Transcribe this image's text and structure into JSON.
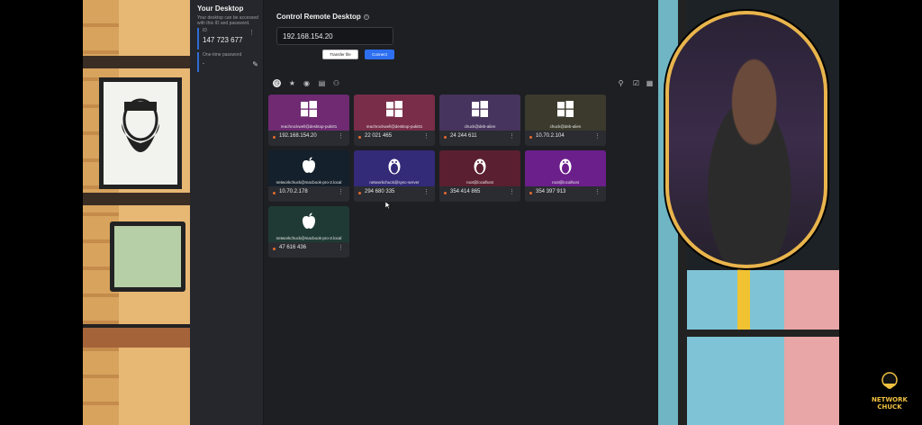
{
  "sidebar": {
    "title": "Your Desktop",
    "description": "Your desktop can be accessed with this ID and password.",
    "id_label": "ID",
    "id_value": "147 723 677",
    "password_label": "One-time password",
    "password_value": "-"
  },
  "remote": {
    "title": "Control Remote Desktop",
    "address_value": "192.168.154.20",
    "transfer_label": "Transfer file",
    "connect_label": "Connect"
  },
  "toolbar": {
    "icons": [
      "recent-icon",
      "favorites-icon",
      "discovered-icon",
      "address-book-icon",
      "group-icon"
    ],
    "right_icons": [
      "search-icon",
      "select-icon",
      "grid-view-icon"
    ]
  },
  "devices": [
    {
      "host": "reachrockwell@desktop-puki81",
      "id": "192.168.154.20",
      "os": "windows",
      "color": "#6f2a72"
    },
    {
      "host": "reachrockwell@desktop-puki81",
      "id": "22 021 465",
      "os": "windows",
      "color": "#7a2d48"
    },
    {
      "host": "chuck@deb-alien",
      "id": "24 244 611",
      "os": "windows",
      "color": "#47345e"
    },
    {
      "host": "chuck@deb-alien",
      "id": "10.70.2.104",
      "os": "windows",
      "color": "#3b3a2d"
    },
    {
      "host": "networkchuck@macbook-pro-2.local",
      "id": "10.70.2.178",
      "os": "apple",
      "color": "#14202b"
    },
    {
      "host": "networkchuck@sync-server",
      "id": "294 680 335",
      "os": "linux",
      "color": "#332a78"
    },
    {
      "host": "root@localhost",
      "id": "354 414 865",
      "os": "linux",
      "color": "#5a1f30"
    },
    {
      "host": "root@localhost",
      "id": "354 397 913",
      "os": "linux",
      "color": "#6a1f8a"
    },
    {
      "host": "networkchuck@macbook-pro-2.local",
      "id": "47 616 436",
      "os": "apple",
      "color": "#1f3a34"
    }
  ],
  "watermark": "NETWORK CHUCK"
}
